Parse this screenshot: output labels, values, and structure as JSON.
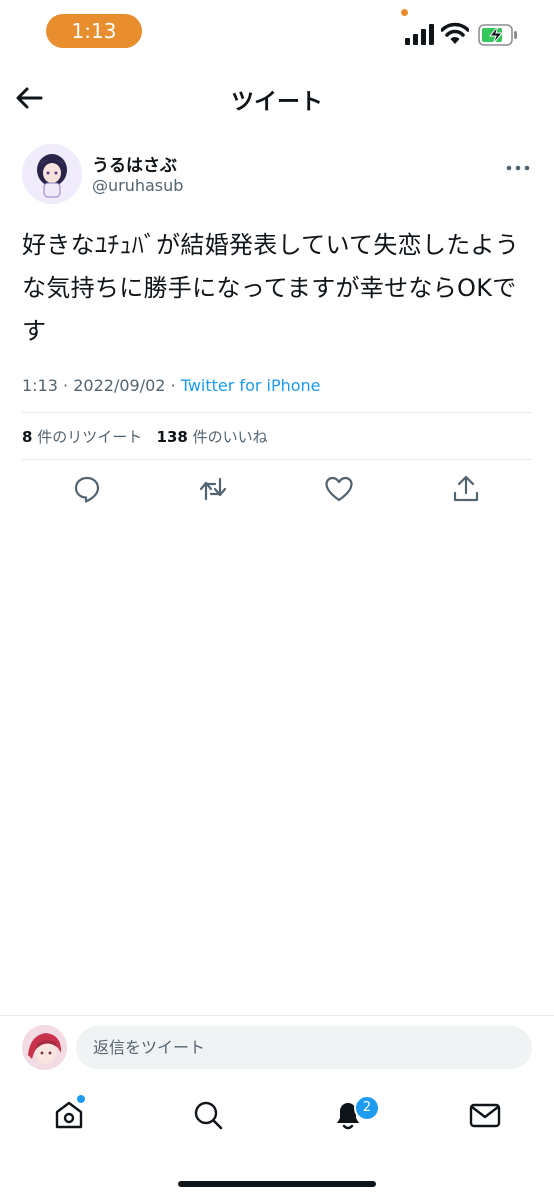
{
  "status_bar": {
    "time": "1:13"
  },
  "header": {
    "title": "ツイート",
    "back_icon": "arrow-left-icon"
  },
  "tweet": {
    "author_name": "うるはさぶ",
    "author_handle": "@uruhasub",
    "text": "好きなﾕﾁｭﾊﾞが結婚発表していて失恋したような気持ちに勝手になってますが幸せならOKです",
    "time": "1:13",
    "separator": "·",
    "date": "2022/09/02",
    "source": "Twitter for iPhone",
    "retweet_count": "8",
    "retweet_label": "件のリツイート",
    "like_count": "138",
    "like_label": "件のいいね"
  },
  "actions": [
    "reply-icon",
    "retweet-icon",
    "like-icon",
    "share-icon"
  ],
  "reply_bar": {
    "placeholder": "返信をツイート"
  },
  "tab_bar": {
    "tabs": [
      "home-icon",
      "search-icon",
      "notifications-icon",
      "messages-icon"
    ],
    "notification_badge": "2"
  },
  "colors": {
    "accent": "#1d9bf0",
    "status_pill": "#e88e2e",
    "battery_green": "#34c759",
    "text": "#0f1419",
    "secondary": "#536471"
  }
}
